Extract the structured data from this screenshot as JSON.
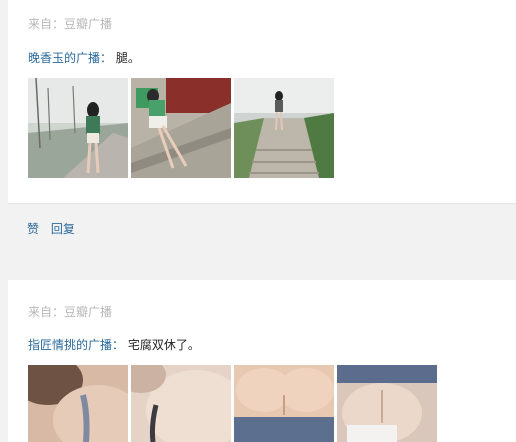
{
  "posts": [
    {
      "source": "来自：豆瓣广播",
      "author": "晚香玉的广播：",
      "text": "腿。",
      "images": [
        {
          "icon": "photo-icon",
          "subject": "woman-walking-road"
        },
        {
          "icon": "photo-icon",
          "subject": "woman-sitting-stone-steps"
        },
        {
          "icon": "photo-icon",
          "subject": "woman-on-stairs-park"
        }
      ]
    },
    {
      "source": "来自：豆瓣广播",
      "author": "指匠情挑的广播：",
      "text": "宅腐双休了。",
      "images": [
        {
          "icon": "photo-icon",
          "subject": "shoulder-closeup"
        },
        {
          "icon": "photo-icon",
          "subject": "shoulder-strap-closeup"
        },
        {
          "icon": "photo-icon",
          "subject": "torso-blue-top"
        },
        {
          "icon": "photo-icon",
          "subject": "torso-blue-top-side"
        }
      ]
    }
  ],
  "actions": {
    "like_label": "赞",
    "reply_label": "回复"
  },
  "colors": {
    "link": "#2a6a9c",
    "muted": "#b8b8b8",
    "background": "#f2f2f2",
    "card": "#ffffff"
  }
}
